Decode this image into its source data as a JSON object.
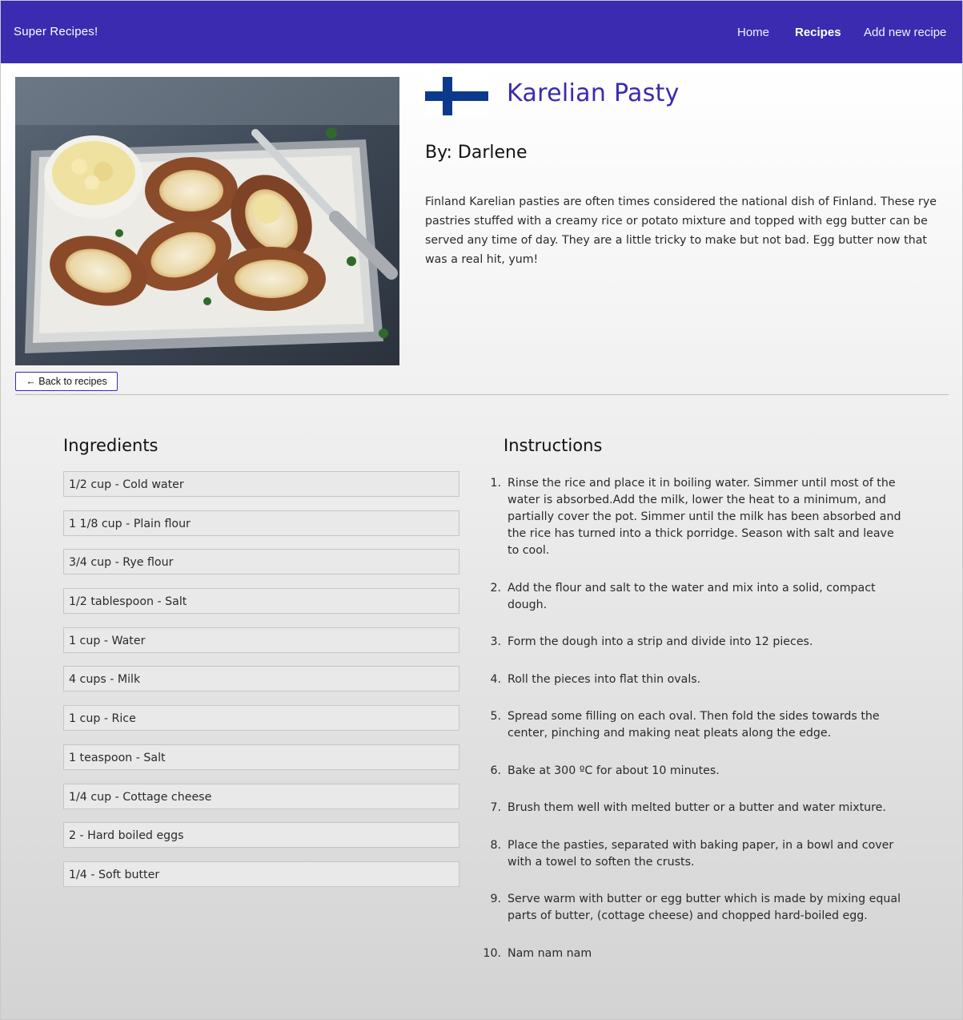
{
  "nav": {
    "brand": "Super Recipes!",
    "links": [
      {
        "label": "Home",
        "active": false
      },
      {
        "label": "Recipes",
        "active": true
      },
      {
        "label": "Add new recipe",
        "active": false
      }
    ]
  },
  "recipe": {
    "title": "Karelian Pasty",
    "author": "By:  Darlene",
    "description": "Finland  Karelian pasties are often times considered the national dish of  Finland. These rye pastries stuffed with a creamy rice or potato mixture and topped with egg butter can be served any time of day. They are a little tricky to make but not bad.  Egg butter now that was a real hit, yum!",
    "flag_country": "Finland",
    "back_label": "← Back to recipes"
  },
  "ingredients": {
    "heading": "Ingredients",
    "items": [
      "1/2 cup - Cold water",
      "1 1/8 cup -  Plain flour",
      "3/4 cup -  Rye flour",
      "1/2 tablespoon - Salt",
      "1 cup - Water",
      "4 cups -  Milk",
      "1 cup -  Rice",
      "1 teaspoon - Salt",
      "1/4 cup - Cottage cheese",
      "2 -  Hard boiled eggs",
      "1/4 - Soft butter"
    ]
  },
  "instructions": {
    "heading": "Instructions",
    "steps": [
      "Rinse the rice and place it in boiling water. Simmer until most of the water is absorbed.Add the milk, lower the heat to a minimum, and partially cover the pot. Simmer until the milk has been absorbed and the rice has turned into a thick porridge. Season with salt and leave to cool.",
      "Add the flour and salt to the water and mix into a solid, compact dough.",
      "Form the dough into a strip and divide into 12 pieces.",
      "Roll the pieces into flat thin ovals.",
      "Spread some filling on each oval. Then fold the sides towards the center, pinching and making neat pleats along the edge.",
      "Bake at 300 ºC for about 10 minutes.",
      "Brush them well with melted butter or a butter and water mixture.",
      "Place the pasties, separated with baking paper, in a bowl and cover with a towel to soften the crusts.",
      "Serve warm with butter or egg butter which is made by mixing equal parts of butter, (cottage cheese) and chopped hard-boiled egg.",
      "Nam nam nam"
    ]
  },
  "colors": {
    "navbar": "#3a2bb0",
    "title": "#3a2bb0",
    "flag_blue": "#0b3a8c"
  }
}
